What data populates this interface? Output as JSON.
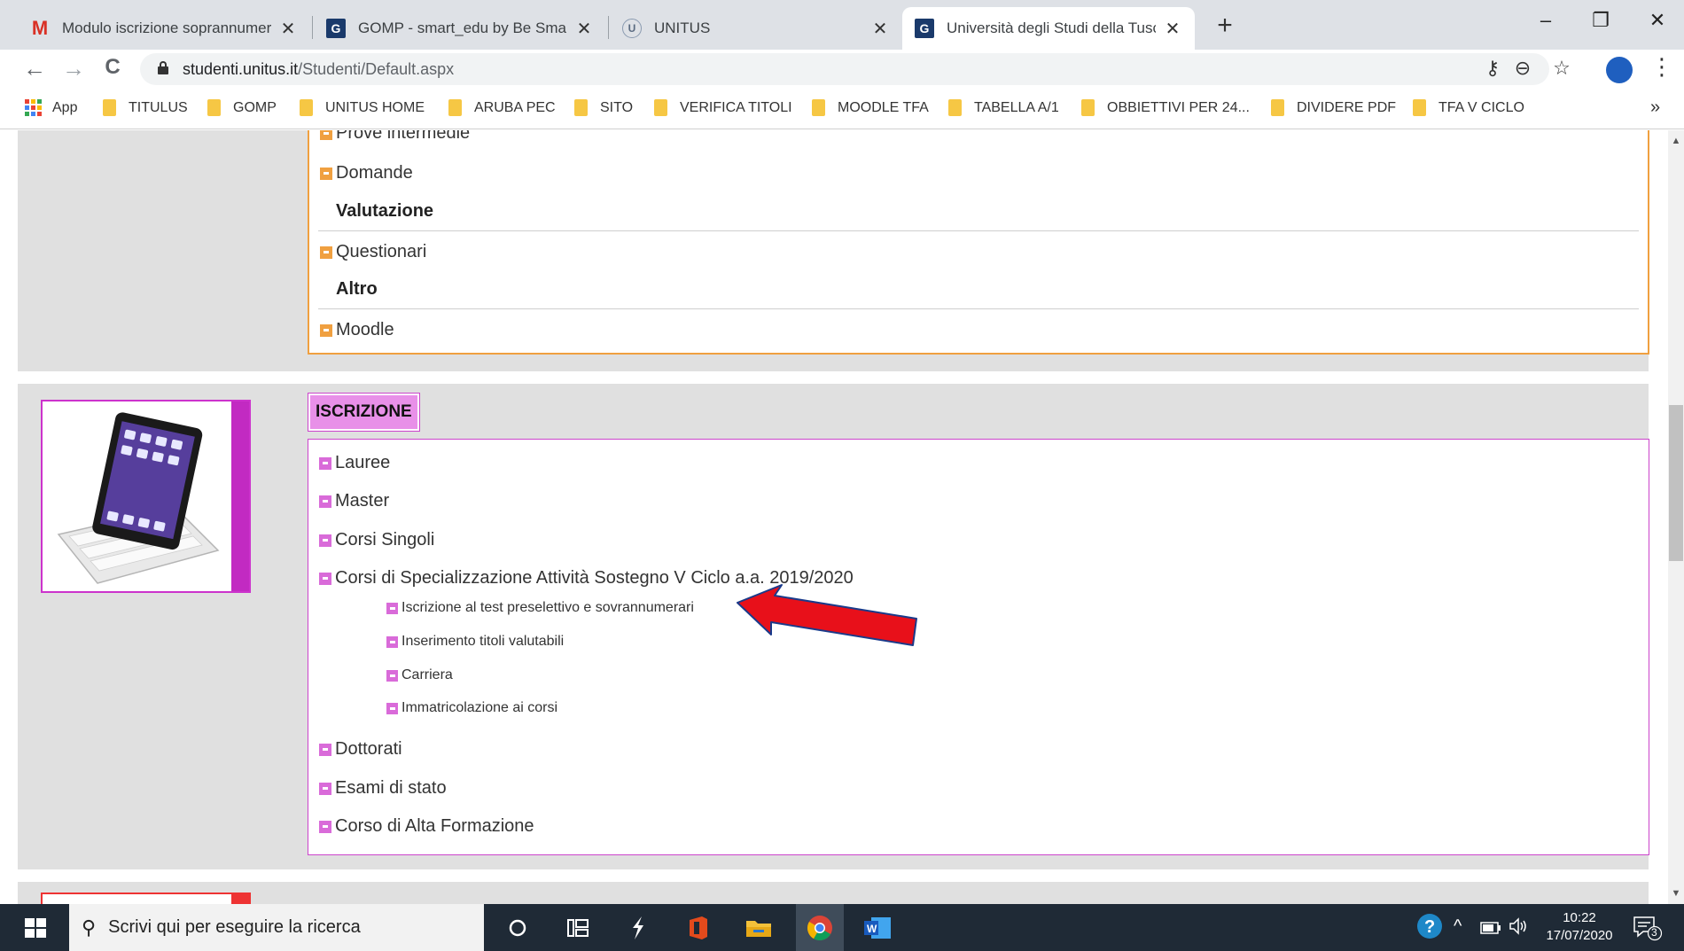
{
  "browser": {
    "tabs": [
      {
        "title": "Modulo iscrizione soprannumerari",
        "favicon": "gmail-icon",
        "close": "✕"
      },
      {
        "title": "GOMP - smart_edu by Be Smart - Gestione",
        "favicon": "gomp-icon",
        "close": "✕"
      },
      {
        "title": "UNITUS",
        "favicon": "unitus-icon",
        "close": "✕"
      },
      {
        "title": "Università degli Studi della Tuscia",
        "favicon": "unitus-icon",
        "close": "✕"
      }
    ],
    "new_tab": "+",
    "window_controls": {
      "minimize": "–",
      "restore": "❐",
      "close": "✕"
    },
    "nav": {
      "back": "←",
      "forward": "→",
      "reload": "C"
    },
    "url": {
      "host": "studenti.unitus.it",
      "path": "/Studenti/Default.aspx"
    },
    "omnibox_icons": {
      "key": "⚷",
      "zoom": "⊖",
      "star": "☆"
    },
    "menu": "⋮",
    "bookmarks": [
      {
        "label": "App",
        "type": "apps"
      },
      {
        "label": "TITULUS",
        "type": "folder"
      },
      {
        "label": "GOMP",
        "type": "folder"
      },
      {
        "label": "UNITUS HOME",
        "type": "folder"
      },
      {
        "label": "ARUBA PEC",
        "type": "folder"
      },
      {
        "label": "SITO",
        "type": "folder"
      },
      {
        "label": "VERIFICA TITOLI",
        "type": "folder"
      },
      {
        "label": "MOODLE TFA",
        "type": "folder"
      },
      {
        "label": "TABELLA A/1",
        "type": "folder"
      },
      {
        "label": "OBBIETTIVI PER 24...",
        "type": "folder"
      },
      {
        "label": "DIVIDERE PDF",
        "type": "folder"
      },
      {
        "label": "TFA V CICLO",
        "type": "folder"
      }
    ],
    "bookmarks_more": "»"
  },
  "didattica_section": {
    "items_top": [
      {
        "label": "Prove intermedie"
      },
      {
        "label": "Domande"
      }
    ],
    "heading_valutazione": "Valutazione",
    "item_questionari": "Questionari",
    "heading_altro": "Altro",
    "item_moodle": "Moodle"
  },
  "iscrizione_section": {
    "title": "ISCRIZIONE",
    "items": [
      {
        "label": "Lauree"
      },
      {
        "label": "Master"
      },
      {
        "label": "Corsi Singoli"
      },
      {
        "label": "Corsi di Specializzazione Attività Sostegno V Ciclo a.a. 2019/2020"
      }
    ],
    "subitems": [
      {
        "label": "Iscrizione al test preselettivo e sovrannumerari"
      },
      {
        "label": "Inserimento titoli valutabili"
      },
      {
        "label": "Carriera"
      },
      {
        "label": "Immatricolazione ai corsi"
      }
    ],
    "items_bottom": [
      {
        "label": "Dottorati"
      },
      {
        "label": "Esami di stato"
      },
      {
        "label": "Corso di Alta Formazione"
      }
    ],
    "annotation_color": "#e8101a"
  },
  "taskbar": {
    "search_placeholder": "Scrivi qui per eseguire la ricerca",
    "time": "10:22",
    "date": "17/07/2020",
    "notifications": "3"
  },
  "colors": {
    "didattica_accent": "#f0a040",
    "iscrizione_accent": "#cc44cc",
    "iscrizione_label_bg": "#e890e8"
  }
}
